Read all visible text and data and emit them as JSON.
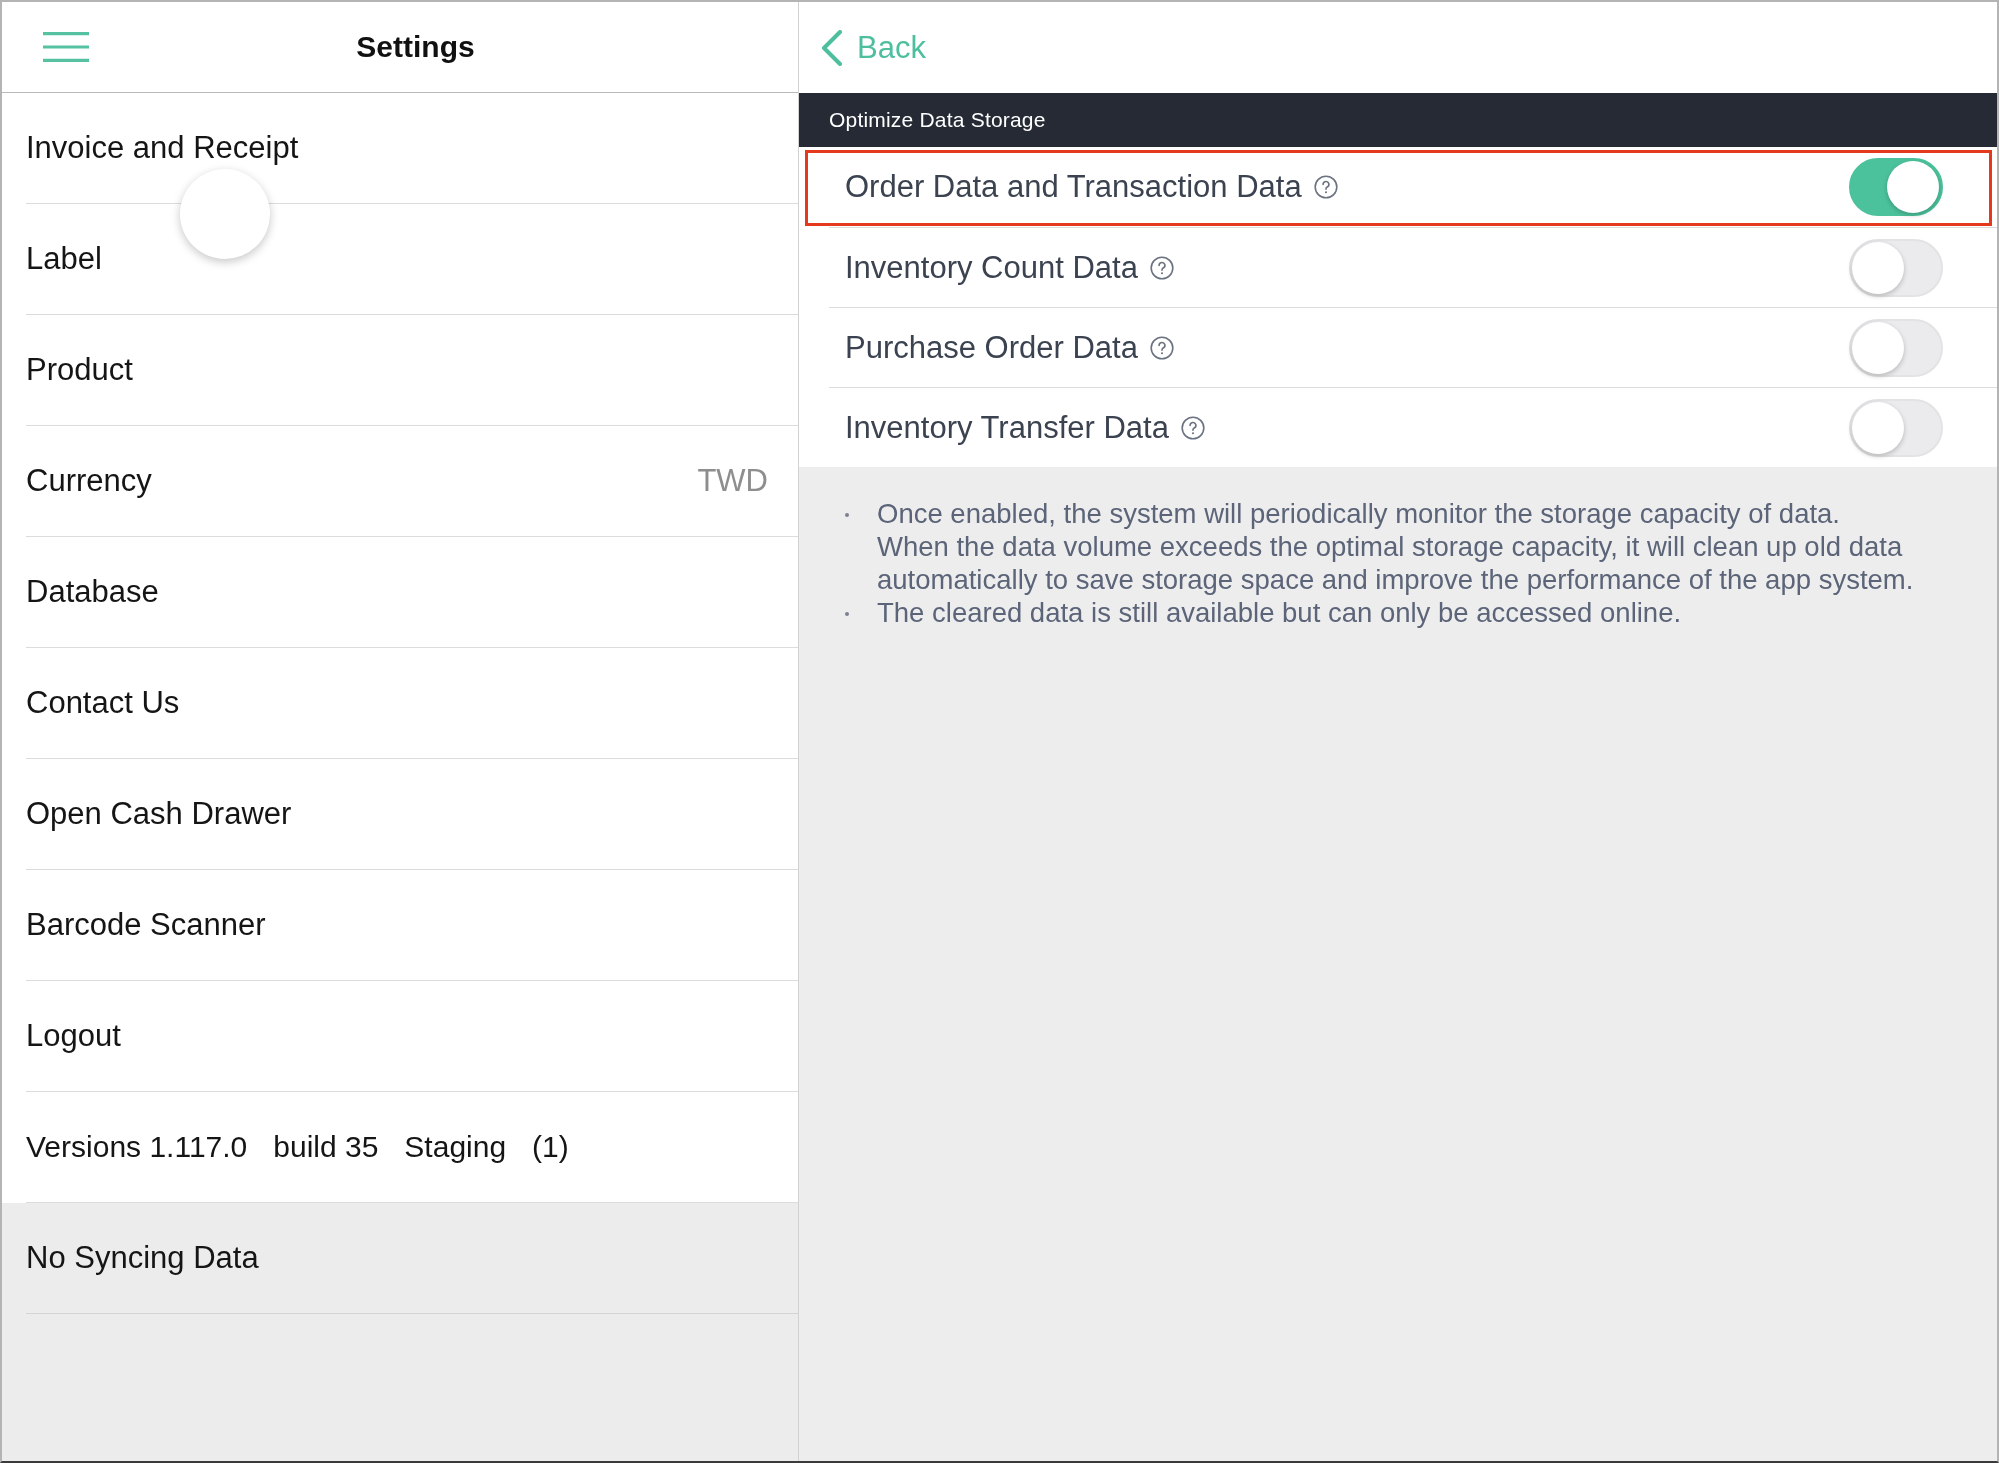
{
  "sidebar": {
    "title": "Settings",
    "items": [
      {
        "label": "Invoice and Receipt"
      },
      {
        "label": "Label"
      },
      {
        "label": "Product"
      },
      {
        "label": "Currency",
        "value": "TWD"
      },
      {
        "label": "Database"
      },
      {
        "label": "Contact Us"
      },
      {
        "label": "Open Cash Drawer"
      },
      {
        "label": "Barcode Scanner"
      },
      {
        "label": "Logout"
      }
    ],
    "version": {
      "parts": [
        "Versions 1.117.0",
        "build 35",
        "Staging",
        "(1)"
      ]
    },
    "sync_status": "No Syncing Data"
  },
  "detail": {
    "back": "Back",
    "section": "Optimize Data Storage",
    "options": [
      {
        "label": "Order Data and Transaction Data",
        "on": true,
        "highlighted": true
      },
      {
        "label": "Inventory Count Data",
        "on": false,
        "highlighted": false
      },
      {
        "label": "Purchase Order Data",
        "on": false,
        "highlighted": false
      },
      {
        "label": "Inventory Transfer Data",
        "on": false,
        "highlighted": false
      }
    ],
    "notes": [
      "Once enabled, the system will periodically monitor the storage capacity of data.\nWhen the data volume exceeds the optimal storage capacity, it will clean up old data automatically to save storage space and improve the performance of the app system.",
      "The cleared data is still available but can only be accessed online."
    ]
  }
}
